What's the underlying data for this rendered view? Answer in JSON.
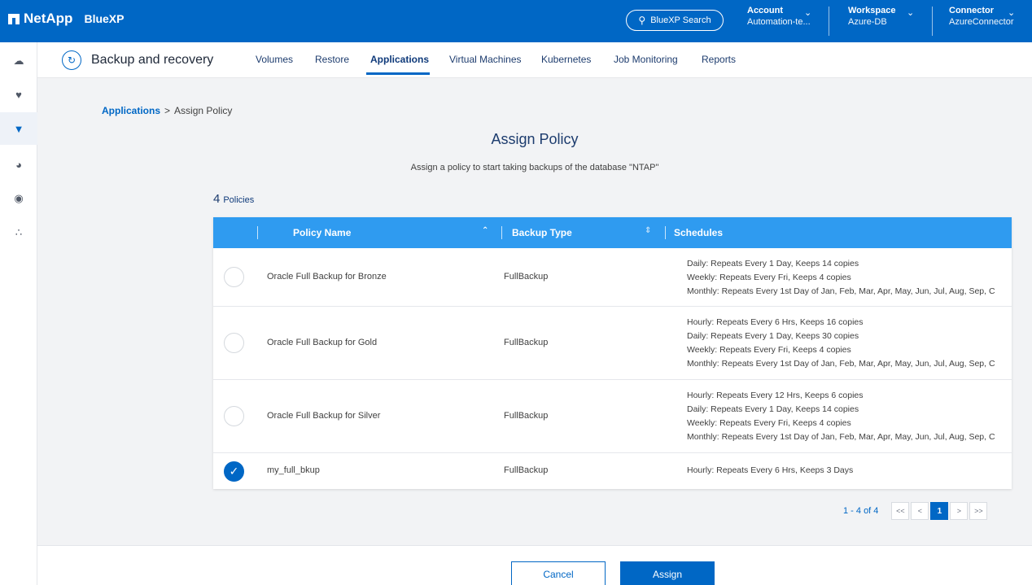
{
  "topbar": {
    "brand": "NetApp",
    "app": "BlueXP",
    "search": "BlueXP Search",
    "account": {
      "title": "Account",
      "value": "Automation-te..."
    },
    "workspace": {
      "title": "Workspace",
      "value": "Azure-DB"
    },
    "connector": {
      "title": "Connector",
      "value": "AzureConnector"
    }
  },
  "rail": {
    "icons": [
      "cloud-icon",
      "shield-heart-icon",
      "shield-icon",
      "gauge-icon",
      "target-icon",
      "share-nodes-icon"
    ],
    "active_index": 2
  },
  "subnav": {
    "service": "Backup and recovery",
    "tabs": [
      {
        "label": "Volumes"
      },
      {
        "label": "Restore"
      },
      {
        "label": "Applications"
      },
      {
        "label": "Virtual Machines"
      },
      {
        "label": "Kubernetes"
      },
      {
        "label": "Job Monitoring"
      },
      {
        "label": "Reports"
      }
    ],
    "active_tab": "Applications"
  },
  "breadcrumb": {
    "parent": "Applications",
    "separator": ">",
    "current": "Assign Policy"
  },
  "page": {
    "title": "Assign Policy",
    "subtitle": "Assign a policy to start taking backups of the database \"NTAP\"",
    "count": "4",
    "count_label": "Policies"
  },
  "table": {
    "columns": {
      "name": "Policy Name",
      "type": "Backup Type",
      "schedules": "Schedules"
    },
    "rows": [
      {
        "name": "Oracle Full Backup for Bronze",
        "type": "FullBackup",
        "selected": false,
        "schedules": [
          "Daily: Repeats Every 1 Day, Keeps 14 copies",
          "Weekly: Repeats Every Fri, Keeps 4 copies",
          "Monthly: Repeats Every 1st Day of Jan, Feb, Mar, Apr, May, Jun, Jul, Aug, Sep, C"
        ]
      },
      {
        "name": "Oracle Full Backup for Gold",
        "type": "FullBackup",
        "selected": false,
        "schedules": [
          "Hourly: Repeats Every 6 Hrs, Keeps 16 copies",
          "Daily: Repeats Every 1 Day, Keeps 30 copies",
          "Weekly: Repeats Every Fri, Keeps 4 copies",
          "Monthly: Repeats Every 1st Day of Jan, Feb, Mar, Apr, May, Jun, Jul, Aug, Sep, C"
        ]
      },
      {
        "name": "Oracle Full Backup for Silver",
        "type": "FullBackup",
        "selected": false,
        "schedules": [
          "Hourly: Repeats Every 12 Hrs, Keeps 6 copies",
          "Daily: Repeats Every 1 Day, Keeps 14 copies",
          "Weekly: Repeats Every Fri, Keeps 4 copies",
          "Monthly: Repeats Every 1st Day of Jan, Feb, Mar, Apr, May, Jun, Jul, Aug, Sep, C"
        ]
      },
      {
        "name": "my_full_bkup",
        "type": "FullBackup",
        "selected": true,
        "schedules": [
          "Hourly: Repeats Every 6 Hrs, Keeps 3 Days"
        ]
      }
    ]
  },
  "pager": {
    "range": "1 - 4 of 4",
    "first": "<<",
    "prev": "<",
    "page": "1",
    "next": ">",
    "last": ">>"
  },
  "footer": {
    "cancel": "Cancel",
    "assign": "Assign"
  },
  "colors": {
    "primary": "#0067c5",
    "header": "#2f9bf0",
    "background": "#f2f3f5"
  }
}
